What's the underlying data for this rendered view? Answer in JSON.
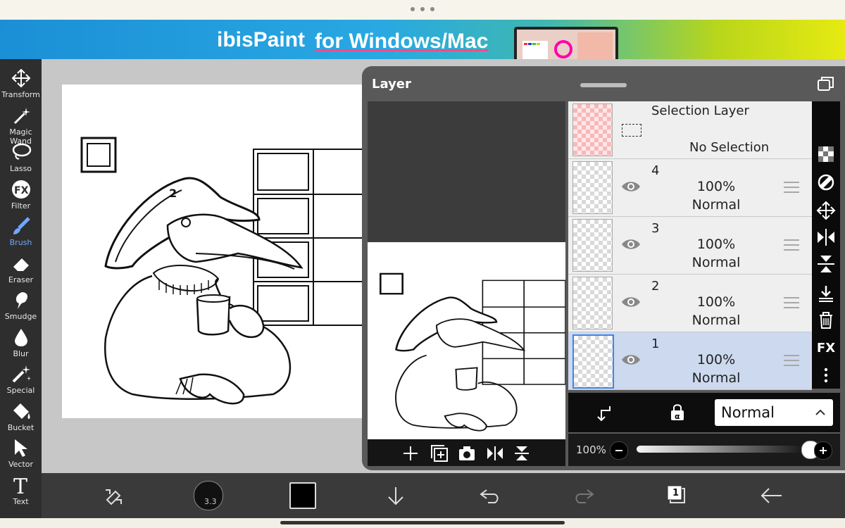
{
  "banner": {
    "brand_prefix": "ibisPaint",
    "brand_suffix": "for Windows/Mac"
  },
  "tools": [
    {
      "id": "transform",
      "label": "Transform",
      "icon": "move-arrows-icon"
    },
    {
      "id": "magic-wand",
      "label": "Magic Wand",
      "icon": "magic-wand-icon"
    },
    {
      "id": "lasso",
      "label": "Lasso",
      "icon": "lasso-icon"
    },
    {
      "id": "filter",
      "label": "Filter",
      "icon": "fx-icon"
    },
    {
      "id": "brush",
      "label": "Brush",
      "icon": "brush-icon",
      "active": true
    },
    {
      "id": "eraser",
      "label": "Eraser",
      "icon": "eraser-icon"
    },
    {
      "id": "smudge",
      "label": "Smudge",
      "icon": "smudge-icon"
    },
    {
      "id": "blur",
      "label": "Blur",
      "icon": "drop-icon"
    },
    {
      "id": "special",
      "label": "Special",
      "icon": "sparkle-pen-icon"
    },
    {
      "id": "bucket",
      "label": "Bucket",
      "icon": "bucket-icon"
    },
    {
      "id": "vector",
      "label": "Vector",
      "icon": "cursor-icon"
    },
    {
      "id": "text",
      "label": "Text",
      "icon": "text-T-icon"
    }
  ],
  "layer_panel": {
    "title": "Layer",
    "selection_layer": {
      "name": "Selection Layer",
      "status": "No Selection"
    },
    "layers": [
      {
        "number": "4",
        "opacity": "100%",
        "mode": "Normal",
        "selected": false
      },
      {
        "number": "3",
        "opacity": "100%",
        "mode": "Normal",
        "selected": false
      },
      {
        "number": "2",
        "opacity": "100%",
        "mode": "Normal",
        "selected": false
      },
      {
        "number": "1",
        "opacity": "100%",
        "mode": "Normal",
        "selected": true
      }
    ],
    "blend_mode": "Normal",
    "opacity_label": "100%",
    "opacity_value": 1.0,
    "right_strip_fx": "FX"
  },
  "bottom_bar": {
    "brush_size": "3.3",
    "layers_badge": "1",
    "color": "#000000"
  }
}
